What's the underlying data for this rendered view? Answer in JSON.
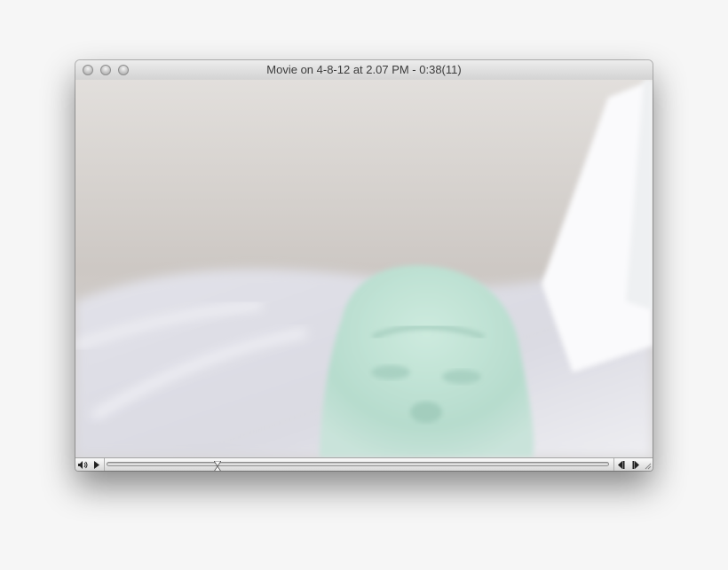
{
  "window": {
    "title": "Movie on 4-8-12 at 2.07 PM - 0:38(11)"
  },
  "traffic_lights": [
    {
      "name": "close-button"
    },
    {
      "name": "minimize-button"
    },
    {
      "name": "zoom-button"
    }
  ],
  "controller": {
    "volume_icon": "speaker-icon",
    "play_icon": "play-icon",
    "step_back_icon": "step-back-icon",
    "step_forward_icon": "step-forward-icon",
    "playhead_position": 0.22
  },
  "video": {
    "content": "webcam-frame",
    "palette": {
      "ceiling": "#cfcac6",
      "wall": "#e6e5ea",
      "face": "#bfe3d6",
      "window_light": "#fbfbfd"
    }
  }
}
